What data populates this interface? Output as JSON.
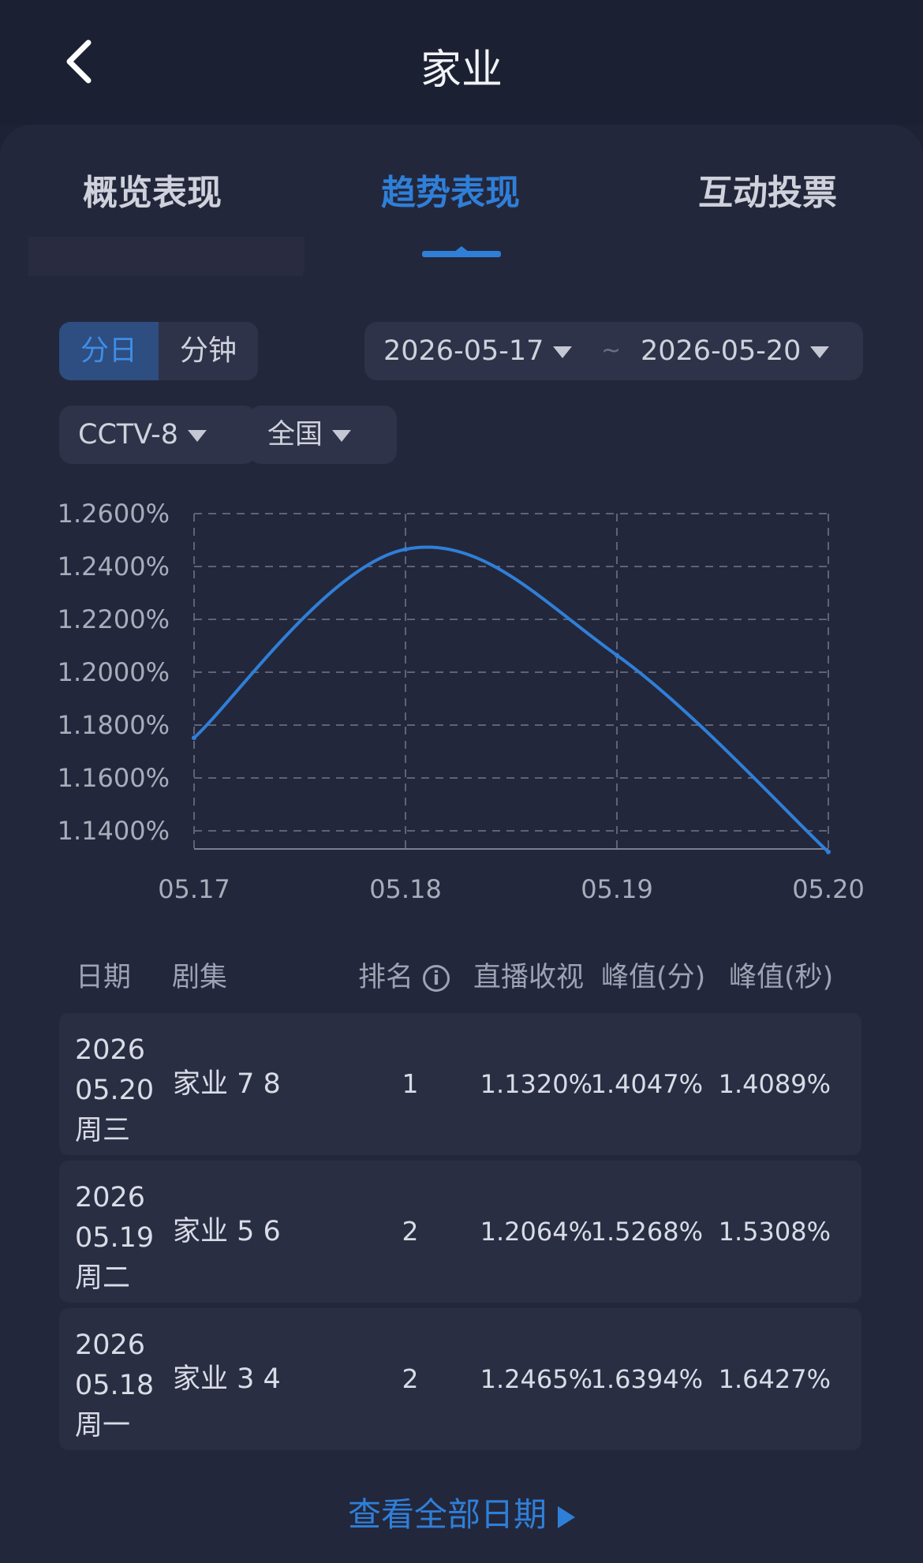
{
  "header": {
    "title": "家业"
  },
  "tabs": [
    {
      "label": "概览表现",
      "active": false
    },
    {
      "label": "趋势表现",
      "active": true
    },
    {
      "label": "互动投票",
      "active": false
    }
  ],
  "filters": {
    "granularity": {
      "options": [
        "分日",
        "分钟"
      ],
      "selected": "分日"
    },
    "date_start": "2026-05-17",
    "date_separator": "~",
    "date_end": "2026-05-20",
    "channel": "CCTV-8",
    "region": "全国"
  },
  "chart_data": {
    "type": "line",
    "x": [
      "05.17",
      "05.18",
      "05.19",
      "05.20"
    ],
    "y": [
      1.1752,
      1.2465,
      1.2064,
      1.132
    ],
    "y_ticks": [
      "1.2600%",
      "1.2400%",
      "1.2200%",
      "1.2000%",
      "1.1800%",
      "1.1600%",
      "1.1400%"
    ],
    "ylim": [
      1.132,
      1.26
    ],
    "grid": true,
    "series_color": "#2f7fd8"
  },
  "table": {
    "headers": [
      "日期",
      "剧集",
      "排名",
      "直播收视",
      "峰值(分)",
      "峰值(秒)"
    ],
    "rows": [
      {
        "year": "2026",
        "date": "05.20",
        "weekday": "周三",
        "episode": "家业 7 8",
        "rank": "1",
        "live": "1.1320%",
        "peak_min": "1.4047%",
        "peak_sec": "1.4089%"
      },
      {
        "year": "2026",
        "date": "05.19",
        "weekday": "周二",
        "episode": "家业 5 6",
        "rank": "2",
        "live": "1.2064%",
        "peak_min": "1.5268%",
        "peak_sec": "1.5308%"
      },
      {
        "year": "2026",
        "date": "05.18",
        "weekday": "周一",
        "episode": "家业 3 4",
        "rank": "2",
        "live": "1.2465%",
        "peak_min": "1.6394%",
        "peak_sec": "1.6427%"
      }
    ]
  },
  "footer": {
    "view_all_label": "查看全部日期"
  },
  "icons": {
    "back": "back-chevron-icon",
    "dropdown": "dropdown-triangle-icon",
    "info": "info-icon",
    "arrow": "play-arrow-icon"
  }
}
